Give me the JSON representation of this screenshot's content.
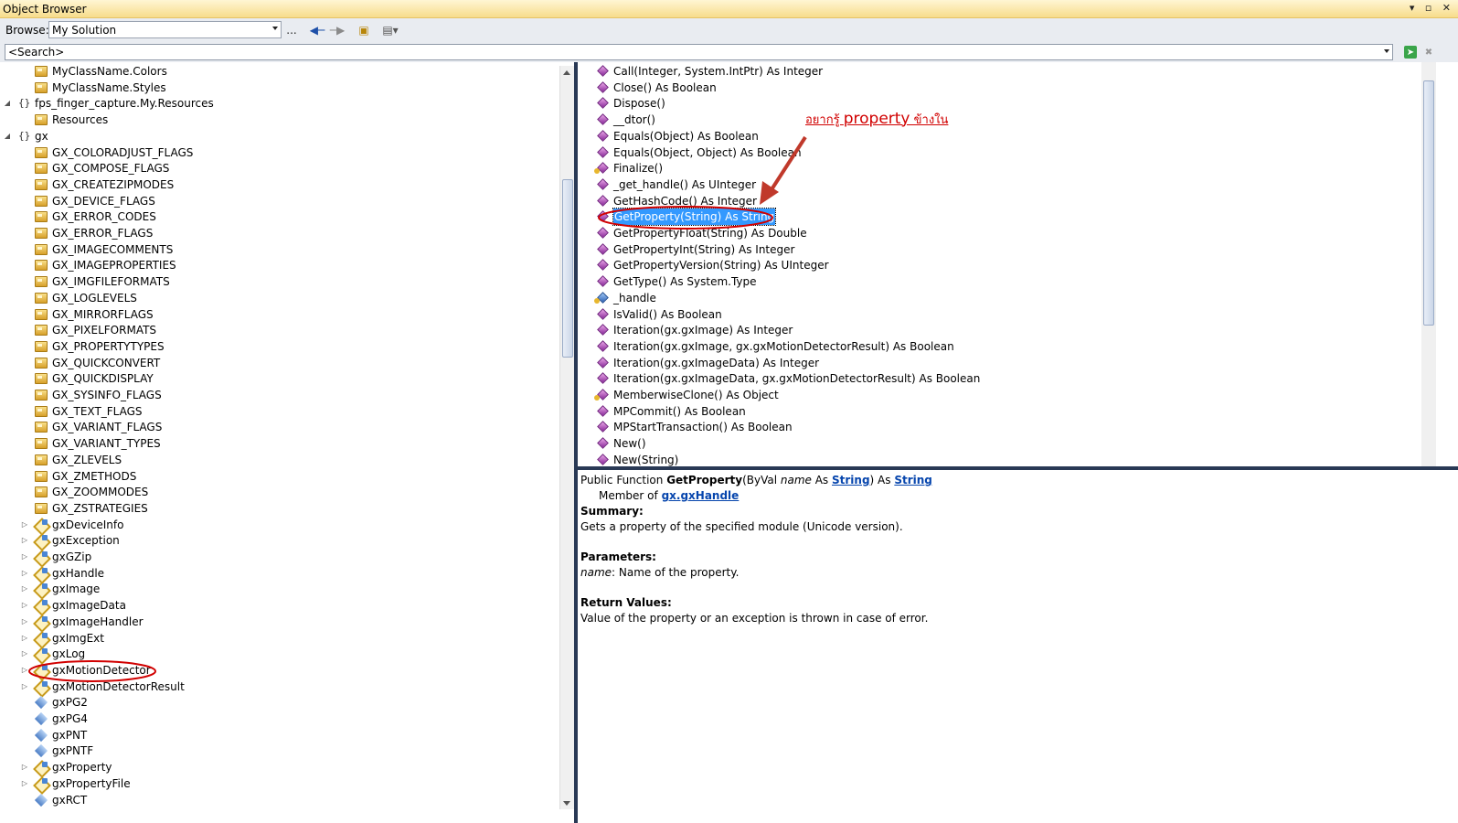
{
  "window": {
    "title": "Object Browser",
    "controls": "▾ ▫ ✕"
  },
  "toolbar": {
    "browse_label": "Browse:",
    "browse_value": "My Solution",
    "more": "..."
  },
  "search": {
    "value": "<Search>"
  },
  "tree": [
    {
      "label": "MyClassName.Colors",
      "icon": "enum",
      "indent": 2,
      "expander": ""
    },
    {
      "label": "MyClassName.Styles",
      "icon": "enum",
      "indent": 2,
      "expander": ""
    },
    {
      "label": "fps_finger_capture.My.Resources",
      "icon": "namespace",
      "indent": 1,
      "expander": "◢"
    },
    {
      "label": "Resources",
      "icon": "enum",
      "indent": 2,
      "expander": ""
    },
    {
      "label": "gx",
      "icon": "namespace",
      "indent": 1,
      "expander": "◢"
    },
    {
      "label": "GX_COLORADJUST_FLAGS",
      "icon": "enum",
      "indent": 2,
      "expander": ""
    },
    {
      "label": "GX_COMPOSE_FLAGS",
      "icon": "enum",
      "indent": 2,
      "expander": ""
    },
    {
      "label": "GX_CREATEZIPMODES",
      "icon": "enum",
      "indent": 2,
      "expander": ""
    },
    {
      "label": "GX_DEVICE_FLAGS",
      "icon": "enum",
      "indent": 2,
      "expander": ""
    },
    {
      "label": "GX_ERROR_CODES",
      "icon": "enum",
      "indent": 2,
      "expander": ""
    },
    {
      "label": "GX_ERROR_FLAGS",
      "icon": "enum",
      "indent": 2,
      "expander": ""
    },
    {
      "label": "GX_IMAGECOMMENTS",
      "icon": "enum",
      "indent": 2,
      "expander": ""
    },
    {
      "label": "GX_IMAGEPROPERTIES",
      "icon": "enum",
      "indent": 2,
      "expander": ""
    },
    {
      "label": "GX_IMGFILEFORMATS",
      "icon": "enum",
      "indent": 2,
      "expander": ""
    },
    {
      "label": "GX_LOGLEVELS",
      "icon": "enum",
      "indent": 2,
      "expander": ""
    },
    {
      "label": "GX_MIRRORFLAGS",
      "icon": "enum",
      "indent": 2,
      "expander": ""
    },
    {
      "label": "GX_PIXELFORMATS",
      "icon": "enum",
      "indent": 2,
      "expander": ""
    },
    {
      "label": "GX_PROPERTYTYPES",
      "icon": "enum",
      "indent": 2,
      "expander": ""
    },
    {
      "label": "GX_QUICKCONVERT",
      "icon": "enum",
      "indent": 2,
      "expander": ""
    },
    {
      "label": "GX_QUICKDISPLAY",
      "icon": "enum",
      "indent": 2,
      "expander": ""
    },
    {
      "label": "GX_SYSINFO_FLAGS",
      "icon": "enum",
      "indent": 2,
      "expander": ""
    },
    {
      "label": "GX_TEXT_FLAGS",
      "icon": "enum",
      "indent": 2,
      "expander": ""
    },
    {
      "label": "GX_VARIANT_FLAGS",
      "icon": "enum",
      "indent": 2,
      "expander": ""
    },
    {
      "label": "GX_VARIANT_TYPES",
      "icon": "enum",
      "indent": 2,
      "expander": ""
    },
    {
      "label": "GX_ZLEVELS",
      "icon": "enum",
      "indent": 2,
      "expander": ""
    },
    {
      "label": "GX_ZMETHODS",
      "icon": "enum",
      "indent": 2,
      "expander": ""
    },
    {
      "label": "GX_ZOOMMODES",
      "icon": "enum",
      "indent": 2,
      "expander": ""
    },
    {
      "label": "GX_ZSTRATEGIES",
      "icon": "enum",
      "indent": 2,
      "expander": ""
    },
    {
      "label": "gxDeviceInfo",
      "icon": "class",
      "indent": 2,
      "expander": "▷"
    },
    {
      "label": "gxException",
      "icon": "class",
      "indent": 2,
      "expander": "▷"
    },
    {
      "label": "gxGZip",
      "icon": "class",
      "indent": 2,
      "expander": "▷"
    },
    {
      "label": "gxHandle",
      "icon": "class",
      "indent": 2,
      "expander": "▷"
    },
    {
      "label": "gxImage",
      "icon": "class",
      "indent": 2,
      "expander": "▷"
    },
    {
      "label": "gxImageData",
      "icon": "class",
      "indent": 2,
      "expander": "▷"
    },
    {
      "label": "gxImageHandler",
      "icon": "class",
      "indent": 2,
      "expander": "▷"
    },
    {
      "label": "gxImgExt",
      "icon": "class",
      "indent": 2,
      "expander": "▷"
    },
    {
      "label": "gxLog",
      "icon": "class",
      "indent": 2,
      "expander": "▷"
    },
    {
      "label": "gxMotionDetector",
      "icon": "class",
      "indent": 2,
      "expander": "▷"
    },
    {
      "label": "gxMotionDetectorResult",
      "icon": "class",
      "indent": 2,
      "expander": "▷"
    },
    {
      "label": "gxPG2",
      "icon": "struct",
      "indent": 2,
      "expander": ""
    },
    {
      "label": "gxPG4",
      "icon": "struct",
      "indent": 2,
      "expander": ""
    },
    {
      "label": "gxPNT",
      "icon": "struct",
      "indent": 2,
      "expander": ""
    },
    {
      "label": "gxPNTF",
      "icon": "struct",
      "indent": 2,
      "expander": ""
    },
    {
      "label": "gxProperty",
      "icon": "class",
      "indent": 2,
      "expander": "▷"
    },
    {
      "label": "gxPropertyFile",
      "icon": "class",
      "indent": 2,
      "expander": "▷"
    },
    {
      "label": "gxRCT",
      "icon": "struct",
      "indent": 2,
      "expander": ""
    }
  ],
  "members": [
    {
      "label": "Call(Integer, System.IntPtr) As Integer",
      "icon": "method"
    },
    {
      "label": "Close() As Boolean",
      "icon": "method"
    },
    {
      "label": "Dispose()",
      "icon": "method"
    },
    {
      "label": "__dtor()",
      "icon": "method"
    },
    {
      "label": "Equals(Object) As Boolean",
      "icon": "method"
    },
    {
      "label": "Equals(Object, Object) As Boolean",
      "icon": "method"
    },
    {
      "label": "Finalize()",
      "icon": "protected-method"
    },
    {
      "label": "_get_handle() As UInteger",
      "icon": "method"
    },
    {
      "label": "GetHashCode() As Integer",
      "icon": "method"
    },
    {
      "label": "GetProperty(String) As String",
      "icon": "method",
      "selected": true
    },
    {
      "label": "GetPropertyFloat(String) As Double",
      "icon": "method"
    },
    {
      "label": "GetPropertyInt(String) As Integer",
      "icon": "method"
    },
    {
      "label": "GetPropertyVersion(String) As UInteger",
      "icon": "method"
    },
    {
      "label": "GetType() As System.Type",
      "icon": "method"
    },
    {
      "label": "_handle",
      "icon": "protected-field"
    },
    {
      "label": "IsValid() As Boolean",
      "icon": "method"
    },
    {
      "label": "Iteration(gx.gxImage) As Integer",
      "icon": "method"
    },
    {
      "label": "Iteration(gx.gxImage, gx.gxMotionDetectorResult) As Boolean",
      "icon": "method"
    },
    {
      "label": "Iteration(gx.gxImageData) As Integer",
      "icon": "method"
    },
    {
      "label": "Iteration(gx.gxImageData, gx.gxMotionDetectorResult) As Boolean",
      "icon": "method"
    },
    {
      "label": "MemberwiseClone() As Object",
      "icon": "protected-method"
    },
    {
      "label": "MPCommit() As Boolean",
      "icon": "method"
    },
    {
      "label": "MPStartTransaction() As Boolean",
      "icon": "method"
    },
    {
      "label": "New()",
      "icon": "method"
    },
    {
      "label": "New(String)",
      "icon": "method"
    }
  ],
  "detail": {
    "sig_prefix": "Public Function ",
    "sig_name": "GetProperty",
    "sig_paren": "(ByVal ",
    "sig_param": "name",
    "sig_as": " As ",
    "sig_type1": "String",
    "sig_close": ") As ",
    "sig_type2": "String",
    "member_of_label": "Member of ",
    "member_of_link": "gx.gxHandle",
    "summary_head": "Summary:",
    "summary_text": "Gets a property of the specified module (Unicode version).",
    "params_head": "Parameters:",
    "param_name": "name",
    "param_desc": ": Name of the property.",
    "return_head": "Return Values:",
    "return_text": "Value of the property or an exception is thrown in case of error."
  },
  "annotation": {
    "prefix": "อยากรู้ ",
    "word": "property",
    "suffix": " ข้างใน",
    "color": "#d10000"
  }
}
